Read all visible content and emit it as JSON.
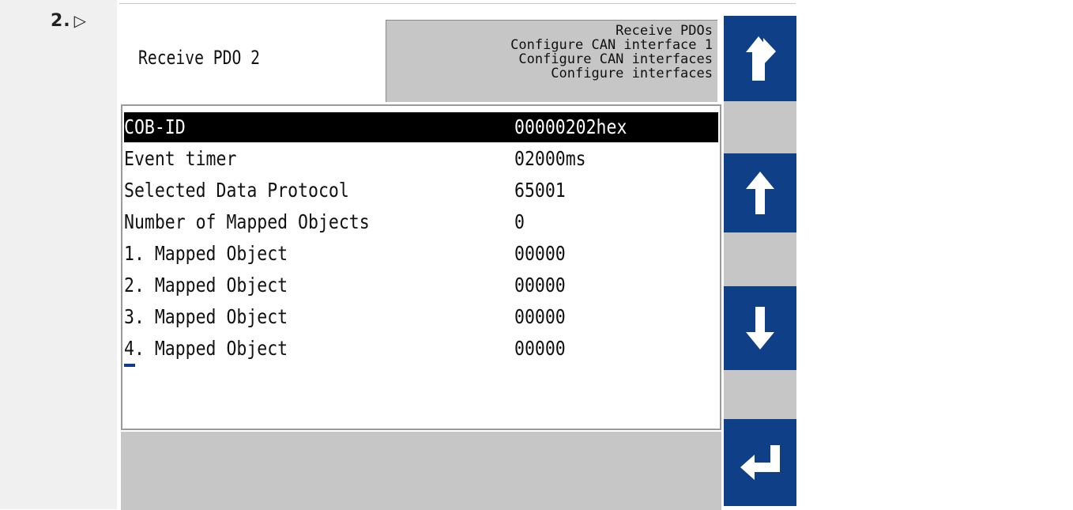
{
  "step": {
    "number": "2.",
    "marker": "▷"
  },
  "screen": {
    "title": "Receive PDO 2",
    "breadcrumb": [
      "Receive PDOs",
      "Configure CAN interface 1",
      "Configure CAN interfaces",
      "Configure interfaces"
    ],
    "rows": [
      {
        "label": "COB-ID",
        "value": "00000202hex",
        "selected": true
      },
      {
        "label": "Event timer",
        "value": "02000ms",
        "selected": false
      },
      {
        "label": "Selected Data Protocol",
        "value": "65001",
        "selected": false
      },
      {
        "label": "Number of Mapped Objects",
        "value": "0",
        "selected": false
      },
      {
        "label": "1. Mapped Object",
        "value": "00000",
        "selected": false
      },
      {
        "label": "2. Mapped Object",
        "value": "00000",
        "selected": false
      },
      {
        "label": "3. Mapped Object",
        "value": "00000",
        "selected": false
      },
      {
        "label": "4. Mapped Object",
        "value": "00000",
        "selected": false
      }
    ]
  },
  "softkeys": [
    {
      "icon": "back-arrow-icon"
    },
    {
      "icon": "arrow-up-icon"
    },
    {
      "icon": "arrow-down-icon"
    },
    {
      "icon": "enter-icon"
    }
  ],
  "colors": {
    "softkey": "#0e3f87",
    "panel_gray": "#c6c6c6",
    "selection": "#000000"
  }
}
